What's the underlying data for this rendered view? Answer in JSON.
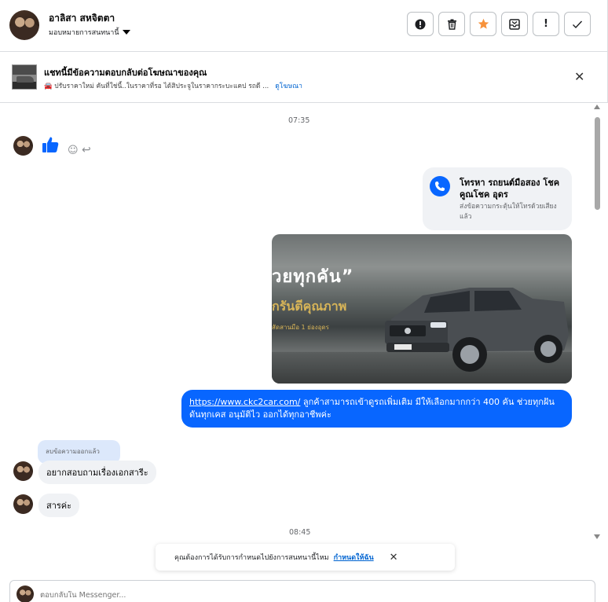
{
  "header": {
    "contact_name": "อาลิสา สหจิตตา",
    "assign_label": "มอบหมายการสนทนานี้",
    "actions": [
      {
        "name": "report-button",
        "glyph": "!"
      },
      {
        "name": "delete-button",
        "glyph": "🗑"
      },
      {
        "name": "star-button",
        "glyph": "★"
      },
      {
        "name": "archive-button",
        "glyph": "✉"
      },
      {
        "name": "mark-spam-button",
        "glyph": "!"
      },
      {
        "name": "mark-done-button",
        "glyph": "✓"
      }
    ]
  },
  "ad_bar": {
    "title": "แชทนี้มีข้อความตอบกลับต่อโฆษณาของคุณ",
    "subtitle": "🚘 ปรับราคาใหม่ คันที่ใช่นี้..ในราคาที่รอ ได้สิประจูในราคากระบะแคป รถดี ...",
    "link": "ดูโฆษณา"
  },
  "thread": {
    "time_1": "07:35",
    "call_card": {
      "title": "โทรหา รถยนต์มือสอง โชคคูณโชค อุดร",
      "subtitle": "ส่งข้อความกระตุ้นให้โทรด้วยเสียงแล้ว"
    },
    "ad_image": {
      "headline": "วยทุกคัน”",
      "gold_text": "กรันตีคุณภาพ",
      "small_text": "สัดสานมือ 1 ย่องอุดร"
    },
    "outgoing_message": {
      "link": "https://www.ckc2car.com/",
      "text": " ลูกค้าสามารถเข้าดูรถเพิ่มเติม มีให้เลือกมากกว่า 400 คัน ช่วยทุกฝัน ดันทุกเคส อนุมัติไว ออกได้ทุกอาชีพค่ะ"
    },
    "deleted_label": "ลบข้อความออกแล้ว",
    "incoming_1": "อยากสอบถามเรื่องเอกสารีะ",
    "incoming_2": "สารค่ะ",
    "time_2": "08:45"
  },
  "toast": {
    "text": "คุณต้องการได้รับการกำหนดไปยังการสนทนานี้ไหม",
    "link": "กำหนดให้ฉัน"
  },
  "composer": {
    "placeholder": "ตอบกลับใน Messenger..."
  },
  "colors": {
    "accent": "#0866ff",
    "bubble_grey": "#f0f2f5",
    "star": "#f7923b"
  }
}
